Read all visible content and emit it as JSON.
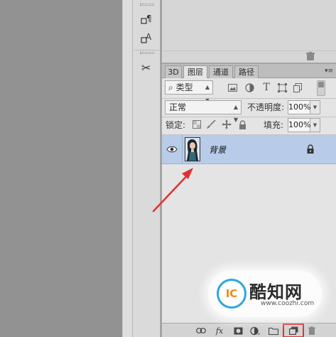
{
  "tool_strip": {
    "tools": [
      {
        "icon": "paragraph-styles-icon",
        "glyph": "¶"
      },
      {
        "icon": "character-styles-icon",
        "glyph": "A"
      },
      {
        "icon": "tool-presets-icon",
        "glyph": "✂"
      }
    ]
  },
  "layers_panel": {
    "tabs": [
      {
        "label": "3D",
        "active": false
      },
      {
        "label": "图层",
        "active": true
      },
      {
        "label": "通道",
        "active": false
      },
      {
        "label": "路径",
        "active": false
      }
    ],
    "panel_menu_glyph": "▾≡",
    "filter": {
      "search_glyph": "⌕",
      "kind_label": "类型",
      "type_icon_glyph": "T"
    },
    "blend_mode": "正常",
    "opacity_label": "不透明度:",
    "opacity_value": "100%",
    "lock_label": "锁定:",
    "fill_label": "填充:",
    "fill_value": "100%",
    "layers": [
      {
        "name": "背景",
        "visible": true,
        "locked": true,
        "selected": true
      }
    ],
    "bottom_icons": {
      "fx_glyph": "fx"
    }
  },
  "watermark": {
    "logo_text": "IC",
    "title": "酷知网",
    "url": "www.coozhi.com"
  },
  "colors": {
    "selected_layer": "#b8cce9",
    "highlight": "#e23030",
    "arrow": "#e23030"
  }
}
